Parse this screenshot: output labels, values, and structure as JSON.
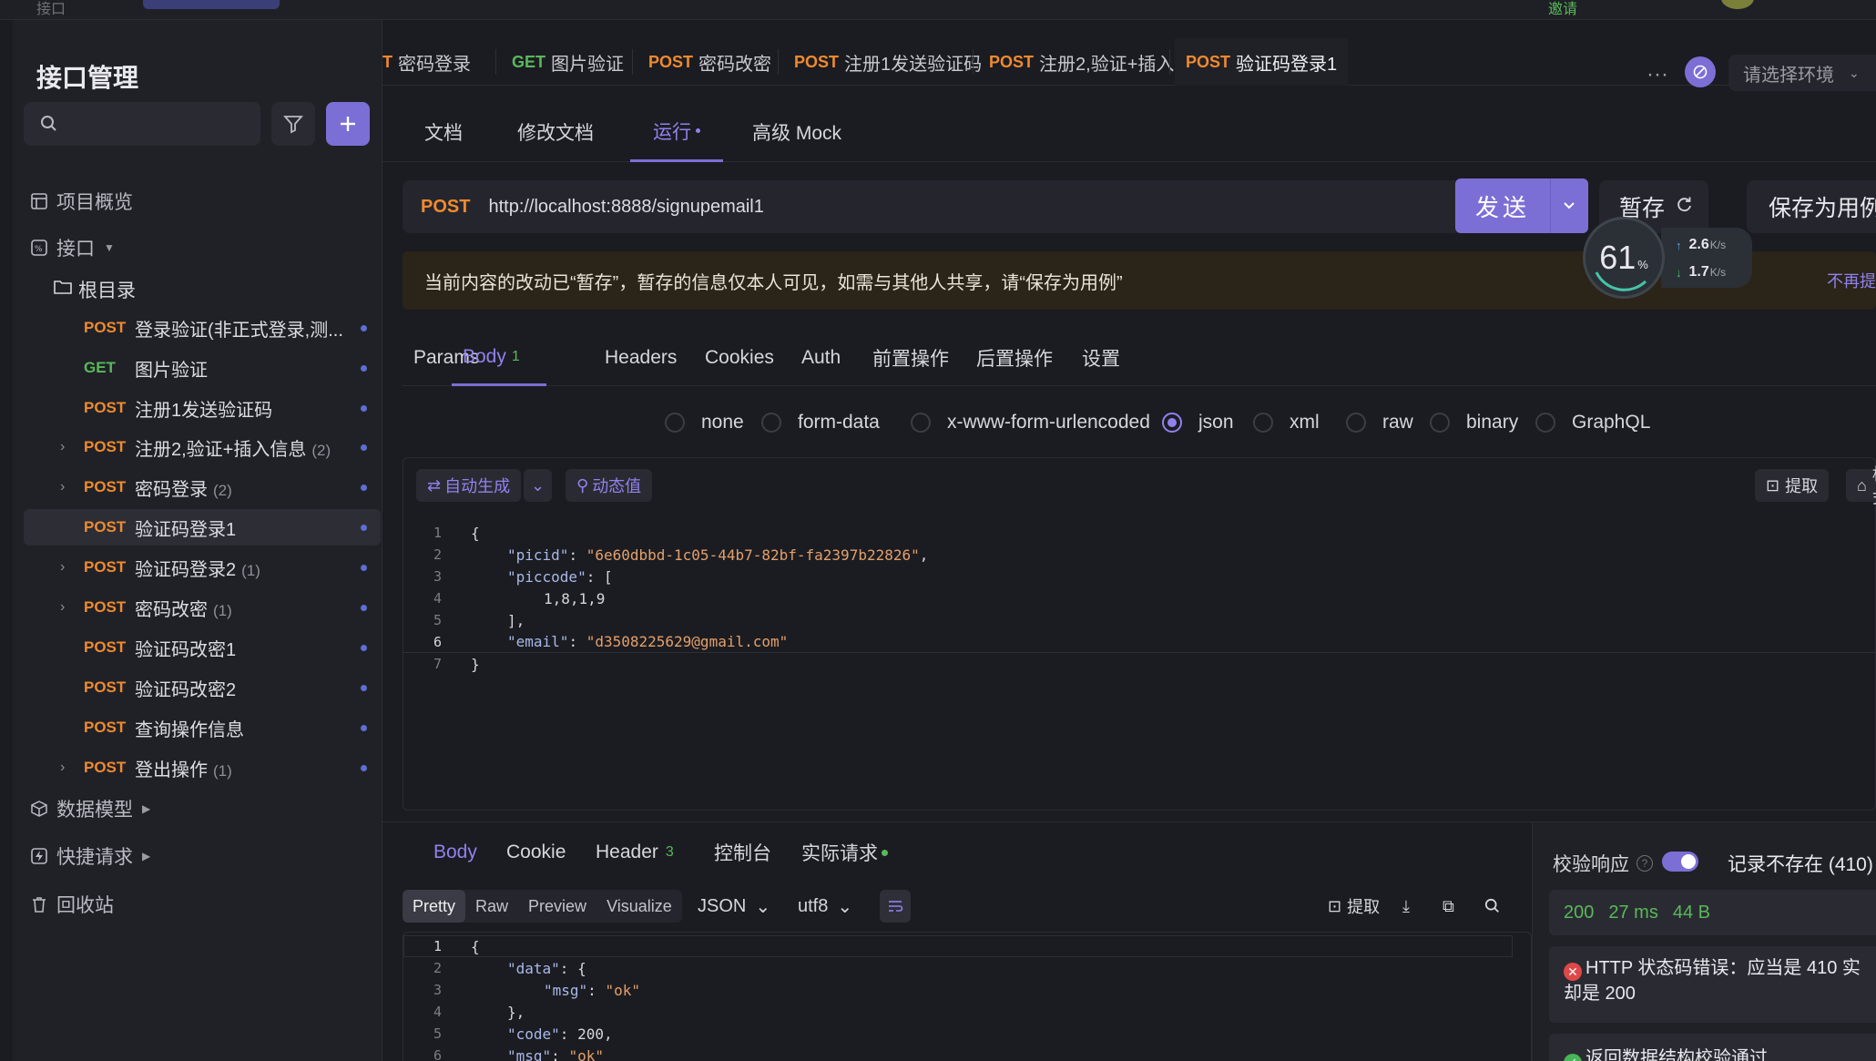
{
  "topbar": {
    "left_text": "接口",
    "right_text": "邀请"
  },
  "sidebar": {
    "title": "接口管理",
    "search_placeholder": "",
    "overview": "项目概览",
    "apis_section": "接口",
    "root_folder": "根目录",
    "items": [
      {
        "method": "POST",
        "name": "登录验证(非正式登录,测...",
        "count": ""
      },
      {
        "method": "GET",
        "name": "图片验证",
        "count": ""
      },
      {
        "method": "POST",
        "name": "注册1发送验证码",
        "count": ""
      },
      {
        "method": "POST",
        "name": "注册2,验证+插入信息",
        "count": "(2)"
      },
      {
        "method": "POST",
        "name": "密码登录",
        "count": "(2)"
      },
      {
        "method": "POST",
        "name": "验证码登录1",
        "count": ""
      },
      {
        "method": "POST",
        "name": "验证码登录2",
        "count": "(1)"
      },
      {
        "method": "POST",
        "name": "密码改密",
        "count": "(1)"
      },
      {
        "method": "POST",
        "name": "验证码改密1",
        "count": ""
      },
      {
        "method": "POST",
        "name": "验证码改密2",
        "count": ""
      },
      {
        "method": "POST",
        "name": "查询操作信息",
        "count": ""
      },
      {
        "method": "POST",
        "name": "登出操作",
        "count": "(1)"
      }
    ],
    "data_models": "数据模型",
    "quick_requests": "快捷请求",
    "recycle_bin": "回收站"
  },
  "tabs": [
    {
      "method": "T",
      "name": "密码登录"
    },
    {
      "method": "GET",
      "name": "图片验证"
    },
    {
      "method": "POST",
      "name": "密码改密"
    },
    {
      "method": "POST",
      "name": "注册1发送验证码"
    },
    {
      "method": "POST",
      "name": "注册2,验证+插入..."
    },
    {
      "method": "POST",
      "name": "验证码登录1"
    }
  ],
  "env_placeholder": "请选择环境",
  "subtabs": [
    "文档",
    "修改文档",
    "运行",
    "高级 Mock"
  ],
  "request": {
    "method": "POST",
    "url": "http://localhost:8888/signupemail1",
    "send_label": "发送",
    "save_temp_label": "暂存",
    "save_case_label": "保存为用例"
  },
  "speed": {
    "percent": "61",
    "percent_unit": "%",
    "up": "2.6",
    "down": "1.7",
    "unit": "K/s"
  },
  "notice": {
    "text": "当前内容的改动已“暂存”，暂存的信息仅本人可见，如需与其他人共享，请“保存为用例”",
    "dismiss": "不再提"
  },
  "req_tabs": [
    {
      "label": "Params",
      "badge": ""
    },
    {
      "label": "Body",
      "badge": "1"
    },
    {
      "label": "Headers",
      "badge": ""
    },
    {
      "label": "Cookies",
      "badge": ""
    },
    {
      "label": "Auth",
      "badge": ""
    },
    {
      "label": "前置操作",
      "badge": ""
    },
    {
      "label": "后置操作",
      "badge": ""
    },
    {
      "label": "设置",
      "badge": ""
    }
  ],
  "body_types": [
    "none",
    "form-data",
    "x-www-form-urlencoded",
    "json",
    "xml",
    "raw",
    "binary",
    "GraphQL"
  ],
  "body_selected": "json",
  "editor_tools": {
    "auto_gen": "自动生成",
    "dynamic": "动态值",
    "extract": "提取",
    "format": "格式"
  },
  "request_body": {
    "line_numbers": [
      "1",
      "2",
      "3",
      "4",
      "5",
      "6",
      "7"
    ],
    "picid_key": "\"picid\"",
    "picid_val": "\"6e60dbbd-1c05-44b7-82bf-fa2397b22826\"",
    "piccode_key": "\"piccode\"",
    "piccode_val": "1,8,1,9",
    "email_key": "\"email\"",
    "email_val": "\"d3508225629@gmail.com\""
  },
  "response": {
    "tabs": [
      {
        "label": "Body",
        "badge": ""
      },
      {
        "label": "Cookie",
        "badge": ""
      },
      {
        "label": "Header",
        "badge": "3"
      },
      {
        "label": "控制台",
        "badge": ""
      },
      {
        "label": "实际请求",
        "badge": ""
      }
    ],
    "views": [
      "Pretty",
      "Raw",
      "Preview",
      "Visualize"
    ],
    "format": "JSON",
    "encoding": "utf8",
    "extract_label": "提取",
    "line_numbers": [
      "1",
      "2",
      "3",
      "4",
      "5",
      "6"
    ],
    "data_key": "\"data\"",
    "msg_key": "\"msg\"",
    "msg_val": "\"ok\"",
    "code_key": "\"code\"",
    "code_val": "200",
    "msg2_key": "\"msg\"",
    "msg2_val": "\"ok\""
  },
  "verify": {
    "label": "校验响应",
    "status_select": "记录不存在 (410)",
    "status": "200",
    "time": "27 ms",
    "size": "44 B",
    "error_line1": "HTTP 状态码错误：应当是 410 实",
    "error_line2": "却是 200",
    "ok_text": "返回数据结构校验通过"
  },
  "colors": {
    "accent": "#7b6fd6",
    "post": "#ef8a2f",
    "get": "#59b85b",
    "error": "#e04848"
  }
}
